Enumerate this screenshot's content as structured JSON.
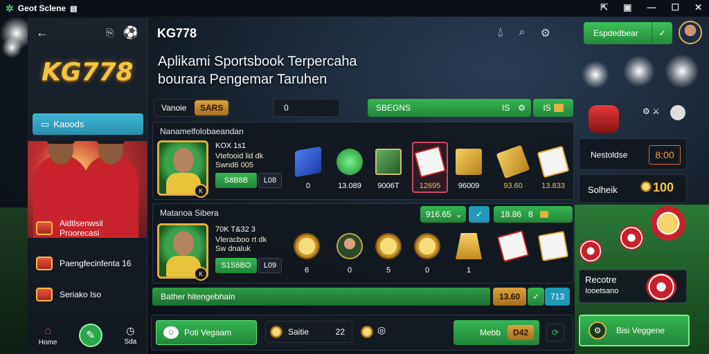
{
  "window": {
    "title": "Geot Sclene",
    "controls": [
      "⇱",
      "▣",
      "—",
      "☐",
      "✕"
    ]
  },
  "sidebar": {
    "brand": "KG778",
    "primary_button": "Kaoods",
    "items": [
      {
        "label": "Aidtlsenwsil\nProorecasi",
        "icon": "treasure-chest-icon"
      },
      {
        "label": "Paengfecinfenta 16",
        "icon": "treasure-chest-icon"
      },
      {
        "label": "Seriako Iso",
        "icon": "treasure-chest-icon"
      }
    ],
    "bottom_nav": [
      {
        "label": "Home",
        "icon": "home-icon"
      },
      {
        "label": "",
        "icon": "pen-icon"
      },
      {
        "label": "Sda",
        "icon": "clock-icon"
      }
    ]
  },
  "header": {
    "app_name": "KG778",
    "cta_label": "Espdedbear",
    "icons": [
      "bell-icon",
      "search-icon",
      "settings-icon"
    ]
  },
  "hero": {
    "title_line1": "Aplikami Sportsbook Terpercaha",
    "title_line2": "bourara Pengemar Taruhen"
  },
  "filter_bar": {
    "tab_label": "Vanoie",
    "tab_value": "SARS",
    "search_value": "0",
    "green_label": "SBEGNS",
    "green_count": "IS",
    "green_extra": "IS"
  },
  "panel1": {
    "title": "Nanamelfolobaeandan",
    "card_name": "KOX 1s1",
    "card_sub1": "Vtefooid lid dk",
    "card_sub2": "Swnd6 005",
    "btn_green": "S8B8B",
    "btn_dark": "L08",
    "assets": [
      {
        "icon": "blue-crate-icon",
        "value": "0"
      },
      {
        "icon": "green-orb-icon",
        "value": "13.089"
      },
      {
        "icon": "loot-box-icon",
        "value": "9006T"
      },
      {
        "icon": "card-deck-icon",
        "value": "12695"
      },
      {
        "icon": "gold-box-icon",
        "value": "96009"
      },
      {
        "icon": "gold-card-icon",
        "value": "93.60"
      },
      {
        "icon": "card-gift-icon",
        "value": "13.833"
      }
    ]
  },
  "panel2": {
    "title": "Matanoa Sibera",
    "pill1": "916.65",
    "pill2": "18.86",
    "pill2b": "8",
    "card_name": "70K T&32 3",
    "card_sub1": "Vleracboo rt dk",
    "card_sub2": "Sw dnaluk",
    "btn_green": "S1S6BO",
    "btn_dark": "L09",
    "assets": [
      {
        "icon": "gold-coin-icon",
        "value": "6"
      },
      {
        "icon": "player-portrait-icon",
        "value": "0"
      },
      {
        "icon": "gold-coin-icon",
        "value": "5"
      },
      {
        "icon": "gold-coin-icon",
        "value": "0"
      },
      {
        "icon": "gold-bars-icon",
        "value": "1"
      },
      {
        "icon": "playing-cards-icon",
        "value": ""
      },
      {
        "icon": "gold-card-icon",
        "value": ""
      }
    ]
  },
  "strip": {
    "label": "Bather hitengebhain",
    "gold_value": "13.60",
    "teal_value": "713"
  },
  "bottom_bar": {
    "left_btn": "Poti Vegaam",
    "mid_label": "Saitie",
    "mid_value": "22",
    "right_btn": "Mebb",
    "right_badge": "D42"
  },
  "right_panel": {
    "top_icons": "⚙ ⚔",
    "row1_label": "Nestoldse",
    "row1_value": "8:00",
    "row2_label": "Solheik",
    "row2_value": "100",
    "promo_title": "Recotre",
    "promo_sub": "Iooetsano",
    "bottom_btn": "Bisi Veggene"
  },
  "colors": {
    "accent_green": "#2fae4b",
    "accent_gold": "#e2b13e",
    "accent_teal": "#2aa6c8"
  }
}
